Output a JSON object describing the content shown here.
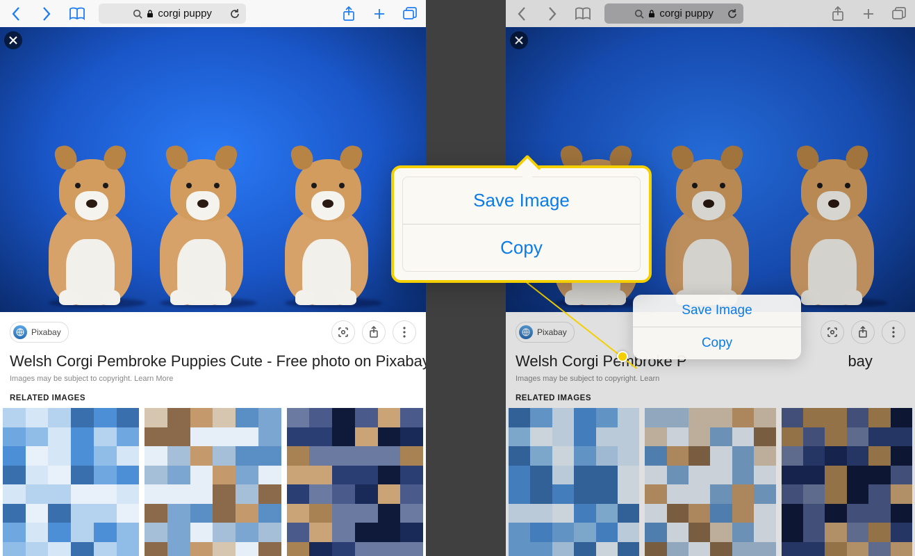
{
  "toolbar": {
    "url_text": "corgi puppy"
  },
  "source": {
    "name": "Pixabay"
  },
  "page": {
    "title": "Welsh Corgi Pembroke Puppies Cute - Free photo on Pixabay",
    "title_truncated_right": "Welsh Corgi Pembroke P",
    "title_suffix_right": "bay",
    "copyright_prefix": "Images may be subject to copyright. ",
    "copyright_link": "Learn More",
    "copyright_truncated": "Images may be subject to copyright. Learn",
    "related_heading": "RELATED IMAGES"
  },
  "popover": {
    "save": "Save Image",
    "copy": "Copy"
  }
}
